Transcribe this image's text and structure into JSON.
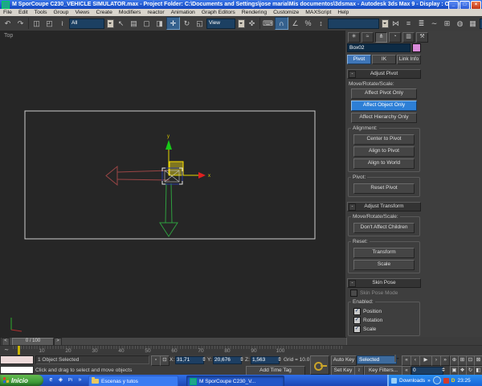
{
  "window": {
    "title": "M SporCoupe C230_VEHICLE SIMULATOR.max    - Project Folder: C:\\Documents and Settings\\jose maria\\Mis documentos\\3dsmax    - Autodesk 3ds Max 9    - Display : OpenGL",
    "minimize": "_",
    "maximize": "□",
    "close": "×"
  },
  "menubar": {
    "items": [
      "File",
      "Edit",
      "Tools",
      "Group",
      "Views",
      "Create",
      "Modifiers",
      "reactor",
      "Animation",
      "Graph Editors",
      "Rendering",
      "Customize",
      "MAXScript",
      "Help"
    ]
  },
  "toolbar": {
    "filter_dropdown": "All",
    "ref_dropdown": "View",
    "named_sel_dropdown": "",
    "preset_dropdown": "View",
    "icons": [
      {
        "name": "undo",
        "glyph": "↶"
      },
      {
        "name": "redo",
        "glyph": "↷"
      },
      {
        "name": "select-and-link",
        "glyph": "◫"
      },
      {
        "name": "unlink-selection",
        "glyph": "◰"
      },
      {
        "name": "bind-to-space-warp",
        "glyph": "≀"
      },
      {
        "name": "select-object",
        "glyph": "↖"
      },
      {
        "name": "select-by-name",
        "glyph": "▤"
      },
      {
        "name": "rectangular-selection-region",
        "glyph": "▢"
      },
      {
        "name": "window-crossing",
        "glyph": "◨"
      },
      {
        "name": "select-and-move",
        "glyph": "✛"
      },
      {
        "name": "select-and-rotate",
        "glyph": "↻"
      },
      {
        "name": "select-and-scale",
        "glyph": "◱"
      },
      {
        "name": "select-and-manipulate",
        "glyph": "✜"
      },
      {
        "name": "keyboard-shortcut-override",
        "glyph": "⌨"
      },
      {
        "name": "snaps-toggle-3d",
        "glyph": "∩"
      },
      {
        "name": "angle-snap",
        "glyph": "∠"
      },
      {
        "name": "percent-snap",
        "glyph": "%"
      },
      {
        "name": "spinner-snap",
        "glyph": "↕"
      },
      {
        "name": "mirror",
        "glyph": "⋈"
      },
      {
        "name": "align",
        "glyph": "≡"
      },
      {
        "name": "layer-manager",
        "glyph": "≣"
      },
      {
        "name": "curve-editor",
        "glyph": "∼"
      },
      {
        "name": "schematic-view",
        "glyph": "⊞"
      },
      {
        "name": "material-editor",
        "glyph": "◍"
      },
      {
        "name": "render-setup",
        "glyph": "▦"
      },
      {
        "name": "quick-render",
        "glyph": "♨"
      }
    ]
  },
  "viewport": {
    "label": "Top",
    "gizmo_x_label": "x",
    "gizmo_y_label": "y"
  },
  "panel": {
    "tabs": [
      {
        "name": "create",
        "glyph": "✳"
      },
      {
        "name": "modify",
        "glyph": "≈"
      },
      {
        "name": "hierarchy",
        "glyph": "⋔"
      },
      {
        "name": "motion",
        "glyph": "◔"
      },
      {
        "name": "display",
        "glyph": "▥"
      },
      {
        "name": "utilities",
        "glyph": "⚒"
      }
    ],
    "object_name": "Box02",
    "modes": {
      "pivot": "Pivot",
      "ik": "IK",
      "link_info": "Link Info"
    },
    "adjust_pivot": {
      "collapse": "-",
      "title": "Adjust Pivot",
      "move_label": "Move/Rotate/Scale:",
      "affect_pivot": "Affect Pivot Only",
      "affect_object": "Affect Object Only",
      "affect_hierarchy": "Affect Hierarchy Only",
      "align_label": "Alignment:",
      "center_to_pivot": "Center to Pivot",
      "align_to_pivot": "Align to Pivot",
      "align_to_world": "Align to World",
      "pivot_label": "Pivot:",
      "reset_pivot": "Reset Pivot"
    },
    "adjust_transform": {
      "collapse": "-",
      "title": "Adjust Transform",
      "move_label": "Move/Rotate/Scale:",
      "dont_affect": "Don't Affect Children",
      "reset_label": "Reset:",
      "transform": "Transform",
      "scale": "Scale"
    },
    "skin_pose": {
      "collapse": "-",
      "title": "Skin Pose",
      "mode_cb": "Skin Pose Mode",
      "enabled_label": "Enabled:",
      "position": "Position",
      "rotation": "Rotation",
      "scale": "Scale",
      "check": "✓"
    }
  },
  "timeline": {
    "prev": "<",
    "next": ">",
    "slider_value": "0 / 100",
    "labels": [
      "10",
      "20",
      "30",
      "40",
      "50",
      "60",
      "70",
      "80",
      "90",
      "100"
    ],
    "mini_curve_glyph": "∼"
  },
  "status": {
    "selection": "1 Object Selected",
    "prompt": "Click and drag to select and move objects",
    "x_label": "X:",
    "x": "31,71",
    "y_label": "Y:",
    "y": "20,676",
    "z_label": "Z:",
    "z": "1,563",
    "grid": "Grid = 10.0",
    "add_time_tag": "Add Time Tag",
    "auto_key": "Auto Key",
    "set_key": "Set Key",
    "selected_dropdown": "Selected",
    "key_filters": "Key Filters...",
    "frame": "0",
    "icons": {
      "lock": "▫",
      "offset_mode": "⊡",
      "key_mode": "≀",
      "goto_start": "«",
      "prev_frame": "‹",
      "play": "▶",
      "next_frame": "›",
      "goto_end": "»",
      "zoom": "⊕",
      "zoom_all": "⊞",
      "zoom_extents": "⊡",
      "zoom_extents_all": "⊠",
      "zoom_region": "▣",
      "pan": "❖",
      "arc_rotate": "↻",
      "minmax_toggle": "◧"
    }
  },
  "taskbar": {
    "start": "Inicio",
    "quick_launch": {
      "ie": "e",
      "shell": "◈",
      "pi": "Pi",
      "more": "»"
    },
    "tasks": [
      {
        "label": "Escenas y tutos"
      },
      {
        "label": "M SporCoupe C230_V..."
      }
    ],
    "tray": {
      "downloads": "Downloads",
      "chevron": "»",
      "d_icon": "D",
      "clock": "23:25"
    }
  }
}
